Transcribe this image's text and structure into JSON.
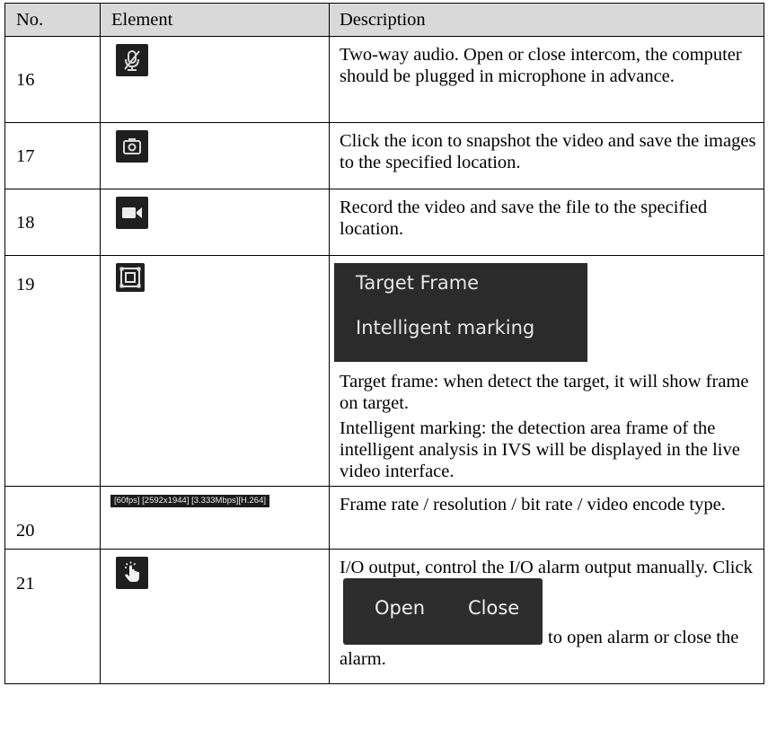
{
  "headers": {
    "no": "No.",
    "element": "Element",
    "description": "Description"
  },
  "rows": [
    {
      "no": "16",
      "icon": "microphone-muted-icon",
      "description": "Two-way audio. Open or close intercom, the computer should be plugged in microphone in advance."
    },
    {
      "no": "17",
      "icon": "camera-snapshot-icon",
      "description": "Click the icon to snapshot the video and save the images to the specified location."
    },
    {
      "no": "18",
      "icon": "video-record-icon",
      "description": "Record the video and save the file to the specified location."
    },
    {
      "no": "19",
      "icon": "target-frame-icon",
      "menu": {
        "item1": "Target Frame",
        "item2": "Intelligent marking"
      },
      "description1": "Target frame: when detect the target, it will show frame on target.",
      "description2": "Intelligent marking: the detection area frame of the intelligent analysis in IVS will be displayed in the live video interface."
    },
    {
      "no": "20",
      "encode_info": "[60fps] [2592x1944] [3.333Mbps][H.264]",
      "description": "Frame rate / resolution / bit rate / video encode type."
    },
    {
      "no": "21",
      "icon": "io-output-hand-icon",
      "description_part1": "I/O output, control the I/O alarm output manually. Click",
      "open_label": "Open",
      "close_label": "Close",
      "description_part2": "to open alarm or close the alarm."
    }
  ]
}
